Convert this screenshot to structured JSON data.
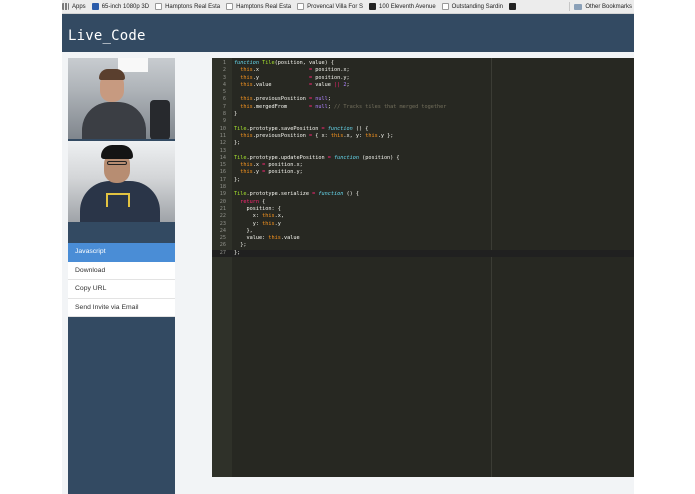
{
  "bookmarks": {
    "apps": "Apps",
    "items": [
      {
        "label": "65-inch 1080p 3D",
        "icon": "tv-icon"
      },
      {
        "label": "Hamptons Real Esta",
        "icon": "page-icon"
      },
      {
        "label": "Hamptons Real Esta",
        "icon": "page-icon"
      },
      {
        "label": "Provencal Villa For S",
        "icon": "page-icon"
      },
      {
        "label": "100 Eleventh Avenue",
        "icon": "building-icon"
      },
      {
        "label": "Outstanding Sardin",
        "icon": "page-icon"
      }
    ],
    "other": "Other Bookmarks"
  },
  "app": {
    "title": "Live_Code"
  },
  "menu": {
    "items": [
      {
        "label": "Javascript"
      },
      {
        "label": "Download"
      },
      {
        "label": "Copy URL"
      },
      {
        "label": "Send Invite via Email"
      }
    ]
  },
  "editor": {
    "active_line": 27,
    "lines": [
      {
        "n": "1",
        "code": "function Tile(position, value) {"
      },
      {
        "n": "2",
        "code": "  this.x                = position.x;"
      },
      {
        "n": "3",
        "code": "  this.y                = position.y;"
      },
      {
        "n": "4",
        "code": "  this.value            = value || 2;"
      },
      {
        "n": "5",
        "code": ""
      },
      {
        "n": "6",
        "code": "  this.previousPosition = null;"
      },
      {
        "n": "7",
        "code": "  this.mergedFrom       = null; // Tracks tiles that merged together"
      },
      {
        "n": "8",
        "code": "}"
      },
      {
        "n": "9",
        "code": ""
      },
      {
        "n": "10",
        "code": "Tile.prototype.savePosition = function () {"
      },
      {
        "n": "11",
        "code": "  this.previousPosition = { x: this.x, y: this.y };"
      },
      {
        "n": "12",
        "code": "};"
      },
      {
        "n": "13",
        "code": ""
      },
      {
        "n": "14",
        "code": "Tile.prototype.updatePosition = function (position) {"
      },
      {
        "n": "15",
        "code": "  this.x = position.x;"
      },
      {
        "n": "16",
        "code": "  this.y = position.y;"
      },
      {
        "n": "17",
        "code": "};"
      },
      {
        "n": "18",
        "code": ""
      },
      {
        "n": "19",
        "code": "Tile.prototype.serialize = function () {"
      },
      {
        "n": "20",
        "code": "  return {"
      },
      {
        "n": "21",
        "code": "    position: {"
      },
      {
        "n": "22",
        "code": "      x: this.x,"
      },
      {
        "n": "23",
        "code": "      y: this.y"
      },
      {
        "n": "24",
        "code": "    },"
      },
      {
        "n": "25",
        "code": "    value: this.value"
      },
      {
        "n": "26",
        "code": "  };"
      },
      {
        "n": "27",
        "code": "};"
      }
    ]
  }
}
